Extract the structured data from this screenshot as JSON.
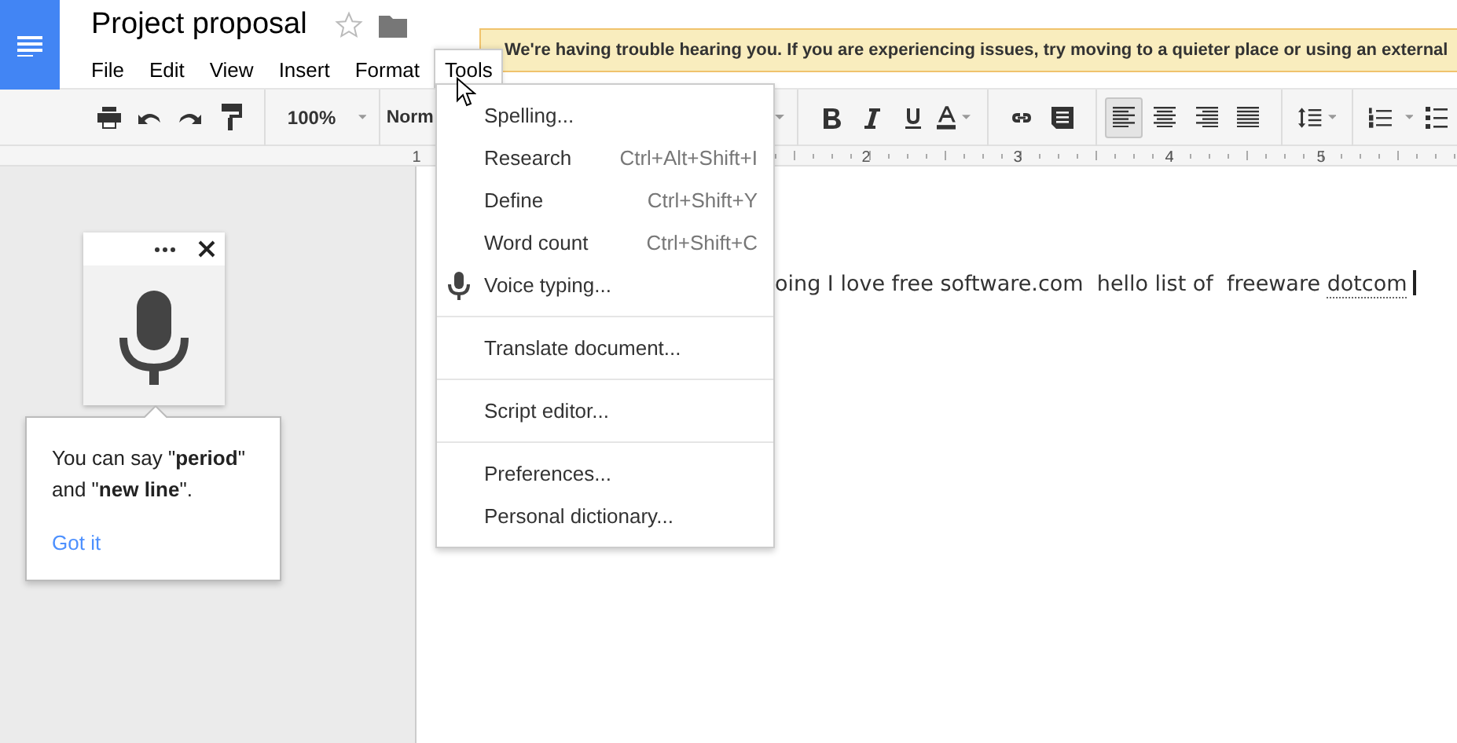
{
  "doc": {
    "title": "Project proposal",
    "starred": false
  },
  "menus": [
    {
      "label": "File",
      "selected": false
    },
    {
      "label": "Edit",
      "selected": false
    },
    {
      "label": "View",
      "selected": false
    },
    {
      "label": "Insert",
      "selected": false
    },
    {
      "label": "Format",
      "selected": false
    },
    {
      "label": "Tools",
      "selected": true
    }
  ],
  "notification": "We're having trouble hearing you. If you are experiencing issues, try moving to a quieter place or using an external",
  "toolbar": {
    "zoom": "100%",
    "style": "Norm",
    "alignment": [
      {
        "kind": "left",
        "selected": true
      },
      {
        "kind": "center",
        "selected": false
      },
      {
        "kind": "right",
        "selected": false
      },
      {
        "kind": "justify",
        "selected": false
      }
    ]
  },
  "ruler": [
    "1",
    "2",
    "3",
    "4",
    "5"
  ],
  "document": {
    "text": "oing I love free software.com  hello list of  freeware",
    "flagged_word": "dotcom"
  },
  "tools_menu": [
    [
      {
        "kind": "plain",
        "label": "Spelling..."
      },
      {
        "kind": "plain",
        "label": "Research",
        "shortcut": "Ctrl+Alt+Shift+I"
      },
      {
        "kind": "plain",
        "label": "Define",
        "shortcut": "Ctrl+Shift+Y"
      },
      {
        "kind": "plain",
        "label": "Word count",
        "shortcut": "Ctrl+Shift+C"
      },
      {
        "kind": "voice",
        "label": "Voice typing..."
      }
    ],
    [
      {
        "kind": "plain",
        "label": "Translate document..."
      }
    ],
    [
      {
        "kind": "plain",
        "label": "Script editor..."
      }
    ],
    [
      {
        "kind": "plain",
        "label": "Preferences..."
      },
      {
        "kind": "plain",
        "label": "Personal dictionary..."
      }
    ]
  ],
  "voice": {
    "tip": "You can say \"**period**\" and \"**new line**\".",
    "action": "Got it"
  }
}
